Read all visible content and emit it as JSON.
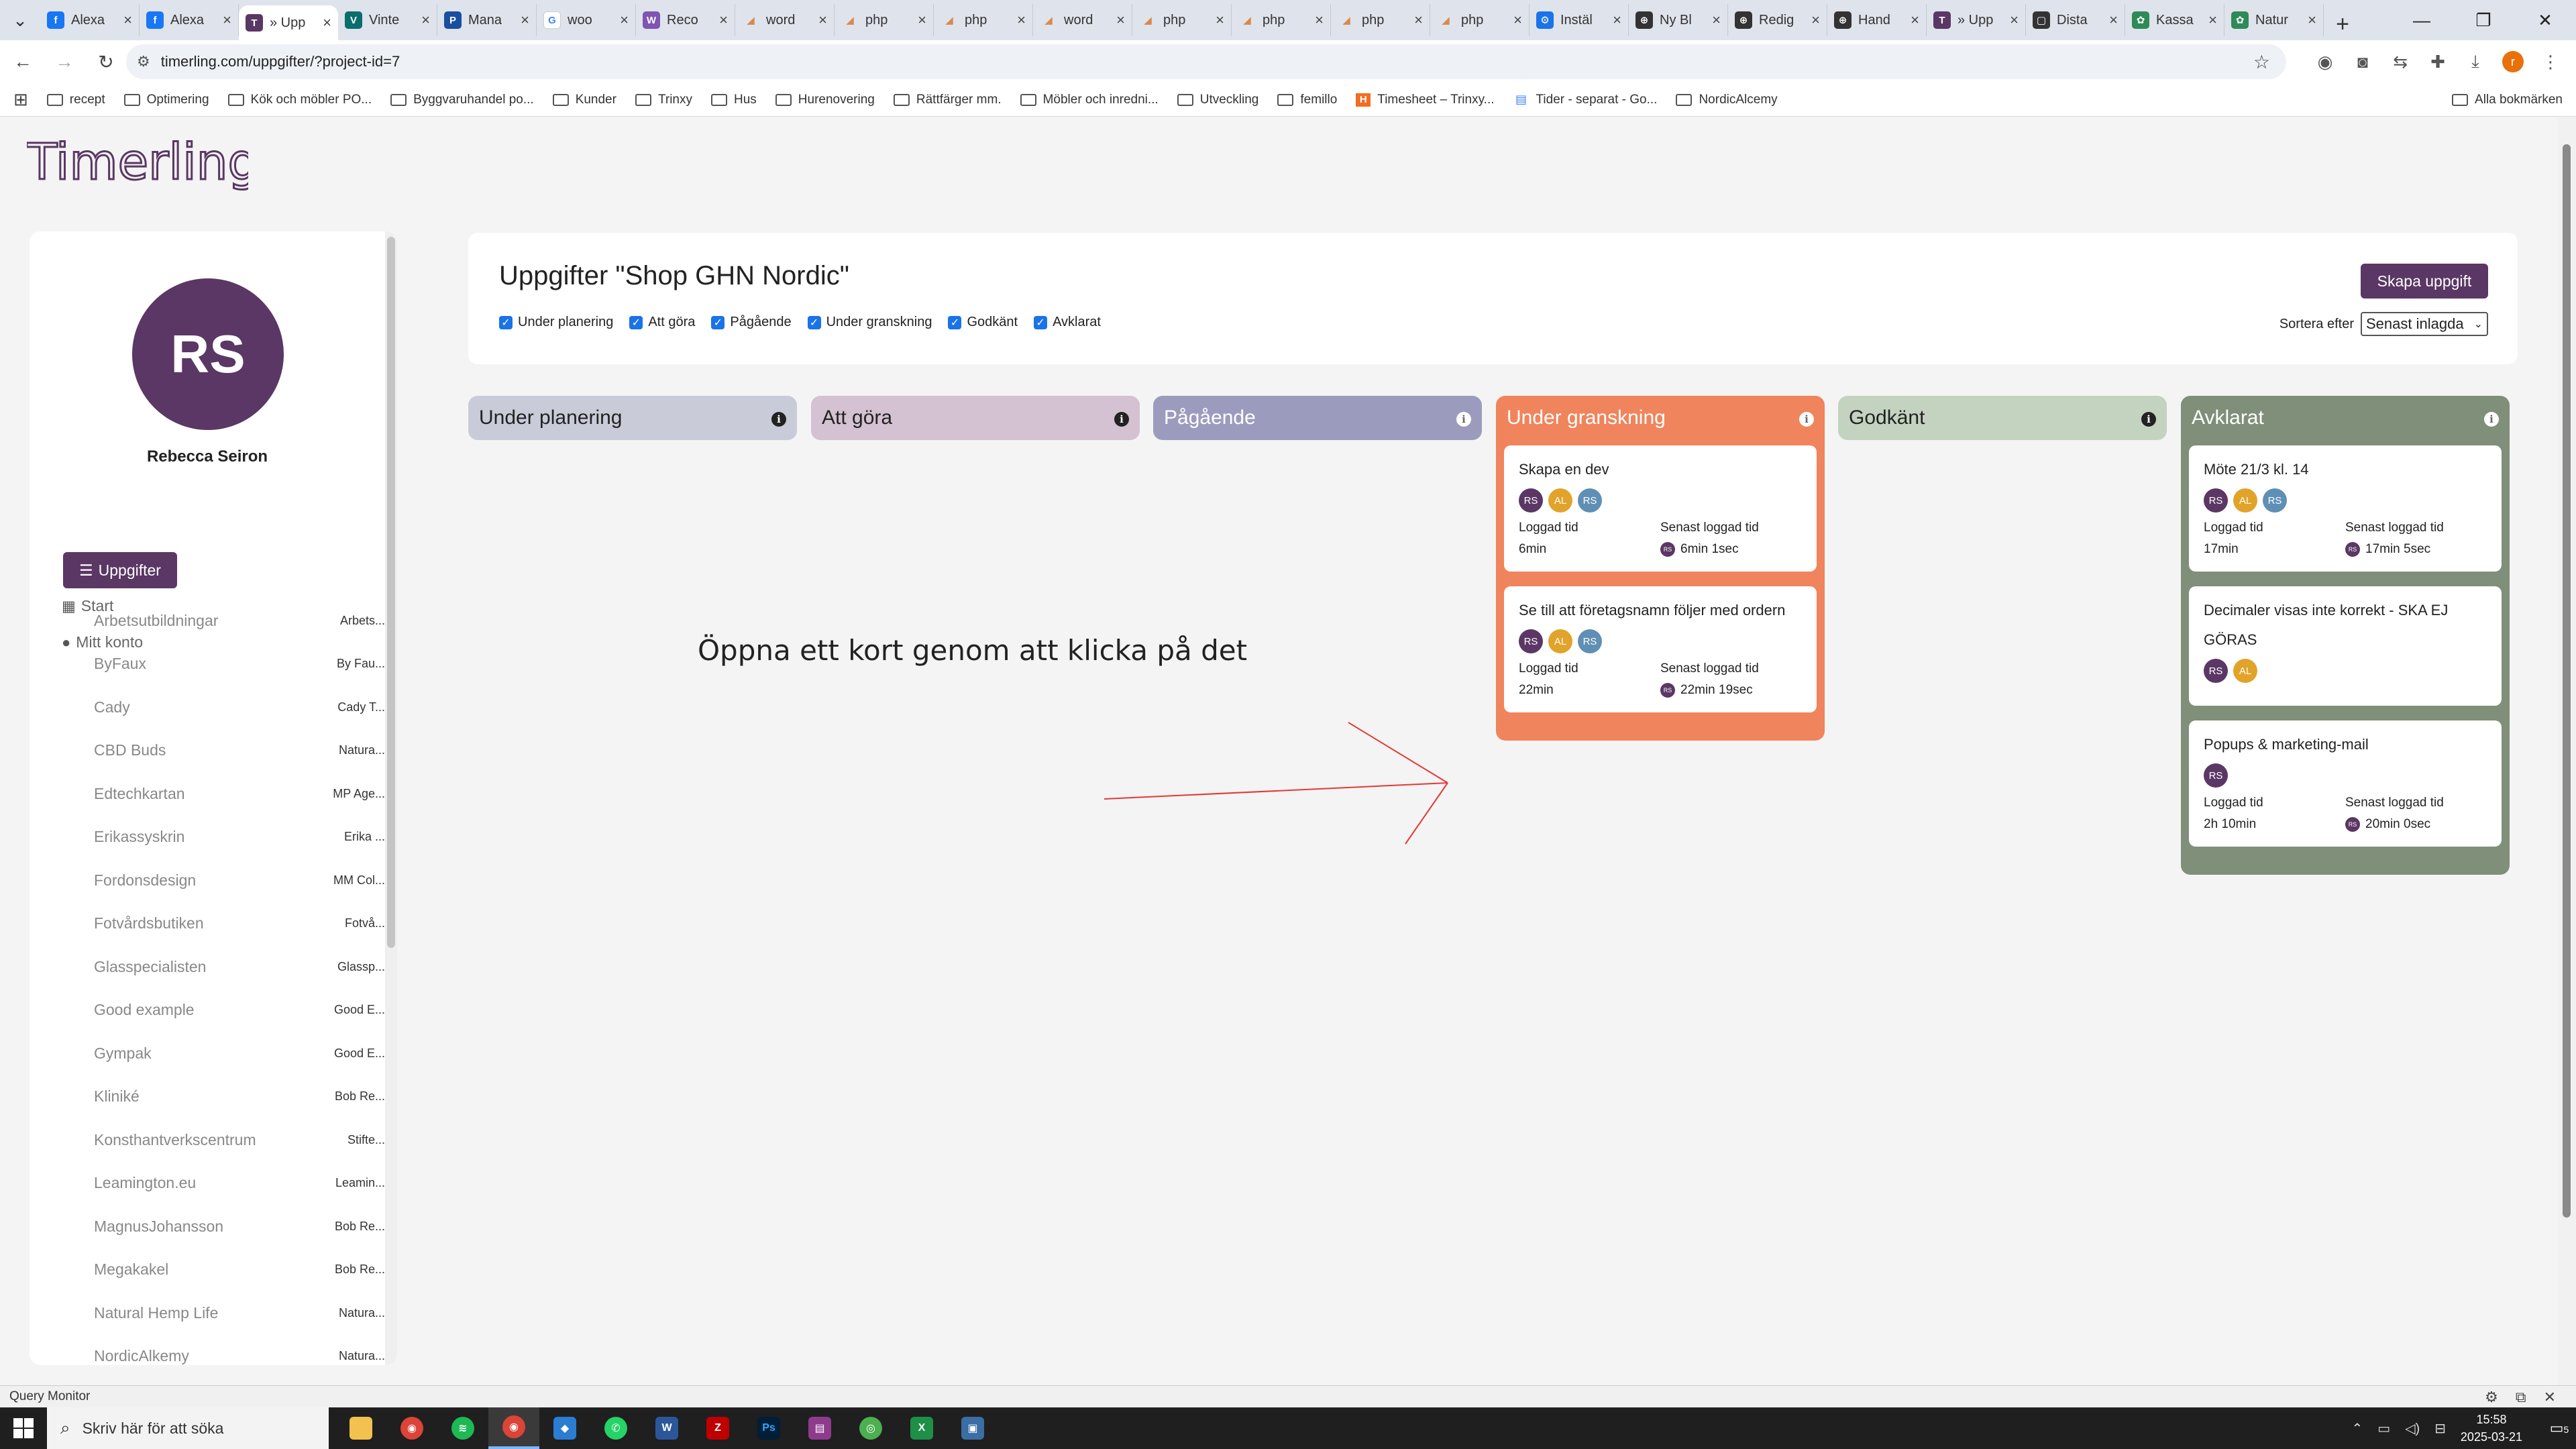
{
  "browser": {
    "tabs": [
      {
        "label": "Alexa",
        "color": "#1877f2",
        "glyph": "f"
      },
      {
        "label": "Alexa",
        "color": "#1877f2",
        "glyph": "f"
      },
      {
        "label": "» Upp",
        "color": "#5a3764",
        "glyph": "T",
        "active": true
      },
      {
        "label": "Vinte",
        "color": "#0b6e6e",
        "glyph": "V"
      },
      {
        "label": "Mana",
        "color": "#1a4fa0",
        "glyph": "P"
      },
      {
        "label": "woo",
        "color": "#ffffff",
        "glyph": "G"
      },
      {
        "label": "Reco",
        "color": "#7f54b3",
        "glyph": "W"
      },
      {
        "label": "word",
        "color": "#d88a4a",
        "glyph": "◢"
      },
      {
        "label": "php",
        "color": "#d88a4a",
        "glyph": "◢"
      },
      {
        "label": "php",
        "color": "#d88a4a",
        "glyph": "◢"
      },
      {
        "label": "word",
        "color": "#d88a4a",
        "glyph": "◢"
      },
      {
        "label": "php",
        "color": "#d88a4a",
        "glyph": "◢"
      },
      {
        "label": "php",
        "color": "#d88a4a",
        "glyph": "◢"
      },
      {
        "label": "php",
        "color": "#d88a4a",
        "glyph": "◢"
      },
      {
        "label": "php",
        "color": "#d88a4a",
        "glyph": "◢"
      },
      {
        "label": "Instäl",
        "color": "#1a73e8",
        "glyph": "⚙"
      },
      {
        "label": "Ny Bl",
        "color": "#333333",
        "glyph": "⊕"
      },
      {
        "label": "Redig",
        "color": "#333333",
        "glyph": "⊕"
      },
      {
        "label": "Hand",
        "color": "#333333",
        "glyph": "⊕"
      },
      {
        "label": "» Upp",
        "color": "#5a3764",
        "glyph": "T"
      },
      {
        "label": "Dista",
        "color": "#333333",
        "glyph": "▢"
      },
      {
        "label": "Kassa",
        "color": "#2e8b57",
        "glyph": "✿"
      },
      {
        "label": "Natur",
        "color": "#2e8b57",
        "glyph": "✿"
      }
    ],
    "url": "timerling.com/uppgifter/?project-id=7",
    "bookmarks": [
      {
        "label": "recept",
        "type": "folder"
      },
      {
        "label": "Optimering",
        "type": "folder"
      },
      {
        "label": "Kök och möbler PO...",
        "type": "folder"
      },
      {
        "label": "Byggvaruhandel po...",
        "type": "folder"
      },
      {
        "label": "Kunder",
        "type": "folder"
      },
      {
        "label": "Trinxy",
        "type": "folder"
      },
      {
        "label": "Hus",
        "type": "folder"
      },
      {
        "label": "Hurenovering",
        "type": "folder"
      },
      {
        "label": "Rättfärger mm.",
        "type": "folder"
      },
      {
        "label": "Möbler och inredni...",
        "type": "folder"
      },
      {
        "label": "Utveckling",
        "type": "folder"
      },
      {
        "label": "femillo",
        "type": "folder"
      },
      {
        "label": "Timesheet – Trinxy...",
        "type": "harvest"
      },
      {
        "label": "Tider - separat - Go...",
        "type": "doc"
      },
      {
        "label": "NordicAlcemy",
        "type": "folder"
      }
    ],
    "all_bookmarks": "Alla bokmärken"
  },
  "app": {
    "logo": "Timerling",
    "user": {
      "initials": "RS",
      "name": "Rebecca Seiron"
    },
    "nav": {
      "start": "Start",
      "account": "Mitt konto",
      "tasks": "Uppgifter"
    },
    "projects": [
      {
        "name": "Arbetsutbildningar",
        "client": "Arbets..."
      },
      {
        "name": "ByFaux",
        "client": "By Fau..."
      },
      {
        "name": "Cady",
        "client": "Cady T..."
      },
      {
        "name": "CBD Buds",
        "client": "Natura..."
      },
      {
        "name": "Edtechkartan",
        "client": "MP Age..."
      },
      {
        "name": "Erikassyskrin",
        "client": "Erika ..."
      },
      {
        "name": "Fordonsdesign",
        "client": "MM Col..."
      },
      {
        "name": "Fotvårdsbutiken",
        "client": "Fotvå..."
      },
      {
        "name": "Glasspecialisten",
        "client": "Glassp..."
      },
      {
        "name": "Good example",
        "client": "Good E..."
      },
      {
        "name": "Gympak",
        "client": "Good E..."
      },
      {
        "name": "Kliniké",
        "client": "Bob Re..."
      },
      {
        "name": "Konsthantverkscentrum",
        "client": "Stifte..."
      },
      {
        "name": "Leamington.eu",
        "client": "Leamin..."
      },
      {
        "name": "MagnusJohansson",
        "client": "Bob Re..."
      },
      {
        "name": "Megakakel",
        "client": "Bob Re..."
      },
      {
        "name": "Natural Hemp Life",
        "client": "Natura..."
      },
      {
        "name": "NordicAlkemy",
        "client": "Natura..."
      }
    ],
    "header": {
      "title": "Uppgifter \"Shop GHN Nordic\"",
      "create_button": "Skapa uppgift",
      "sort_label": "Sortera efter",
      "sort_value": "Senast inlagda",
      "filters": [
        "Under planering",
        "Att göra",
        "Pågående",
        "Under granskning",
        "Godkänt",
        "Avklarat"
      ]
    },
    "columns": [
      {
        "title": "Under planering",
        "color": "#c9cbd8",
        "dark": false,
        "cards": []
      },
      {
        "title": "Att göra",
        "color": "#d4c1d2",
        "dark": false,
        "cards": []
      },
      {
        "title": "Pågående",
        "color": "#9b9cbd",
        "dark": true,
        "cards": []
      },
      {
        "title": "Under granskning",
        "color": "#f0845c",
        "dark": true,
        "cards": [
          {
            "title": "Skapa en dev",
            "avatars": [
              "RS",
              "AL",
              "RS"
            ],
            "logged_label": "Loggad tid",
            "logged": "6min",
            "last_label": "Senast loggad tid",
            "last": "6min 1sec"
          },
          {
            "title": "Se till att företagsnamn följer med ordern",
            "avatars": [
              "RS",
              "AL",
              "RS"
            ],
            "logged_label": "Loggad tid",
            "logged": "22min",
            "last_label": "Senast loggad tid",
            "last": "22min 19sec"
          }
        ]
      },
      {
        "title": "Godkänt",
        "color": "#c4d3c0",
        "dark": false,
        "cards": []
      },
      {
        "title": "Avklarat",
        "color": "#7f8f7a",
        "dark": true,
        "cards": [
          {
            "title": "Möte 21/3 kl. 14",
            "avatars": [
              "RS",
              "AL",
              "RS"
            ],
            "logged_label": "Loggad tid",
            "logged": "17min",
            "last_label": "Senast loggad tid",
            "last": "17min 5sec"
          },
          {
            "title": "Decimaler visas inte korrekt - SKA EJ GÖRAS",
            "avatars": [
              "RS",
              "AL"
            ]
          },
          {
            "title": "Popups & marketing-mail",
            "avatars": [
              "RS"
            ],
            "logged_label": "Loggad tid",
            "logged": "2h 10min",
            "last_label": "Senast loggad tid",
            "last": "20min 0sec"
          }
        ]
      }
    ],
    "avatar_colors": {
      "RS": "#5a3764",
      "AL": "#e2a32a",
      "RS2": "#5f8fb5"
    },
    "annotation": "Öppna ett kort genom att klicka på det"
  },
  "bottom": {
    "query_monitor": "Query Monitor",
    "search_placeholder": "Skriv här för att söka",
    "time": "15:58",
    "date": "2025-03-21",
    "notifications": "5"
  }
}
